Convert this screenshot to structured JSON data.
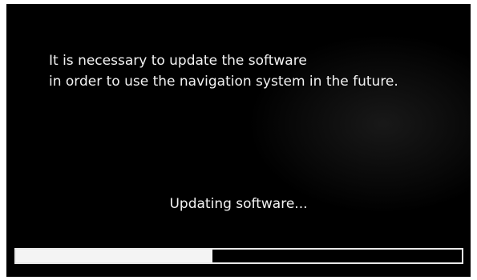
{
  "screen": {
    "message_line_1": "It is necessary to update the software",
    "message_line_2": "in order to use the navigation system in the future.",
    "status_text": "Updating software..."
  },
  "progress": {
    "fraction": 0.44
  },
  "colors": {
    "screen_background": "#000000",
    "text": "#f2f2f2",
    "progress_fill": "#f4f4f4",
    "progress_border": "#e8e8e8"
  }
}
